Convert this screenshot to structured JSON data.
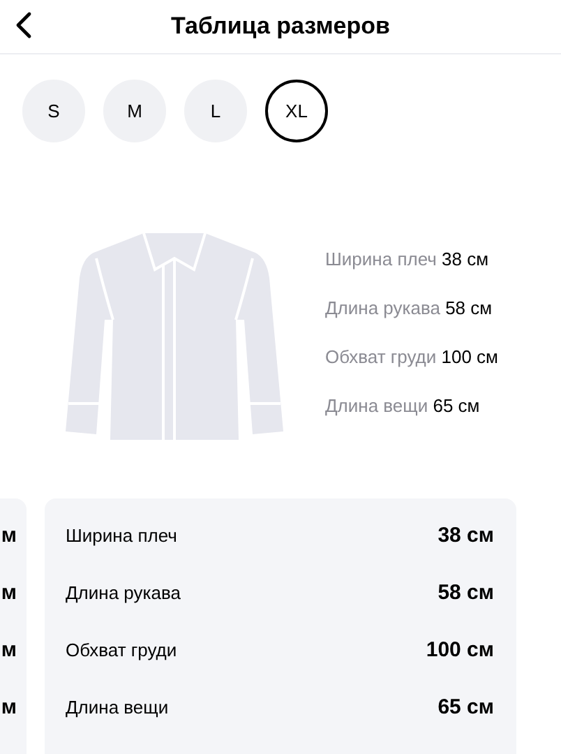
{
  "header": {
    "title": "Таблица размеров"
  },
  "sizes": [
    {
      "label": "S",
      "selected": false
    },
    {
      "label": "M",
      "selected": false
    },
    {
      "label": "L",
      "selected": false
    },
    {
      "label": "XL",
      "selected": true
    }
  ],
  "diagram": {
    "measurements": [
      {
        "label": "Ширина плеч",
        "value": "38 см"
      },
      {
        "label": "Длина рукава",
        "value": "58 см"
      },
      {
        "label": "Обхват груди",
        "value": "100 см"
      },
      {
        "label": "Длина вещи",
        "value": "65 см"
      }
    ]
  },
  "cards": [
    {
      "rows": [
        {
          "value": "м"
        },
        {
          "value": "м"
        },
        {
          "value": "м"
        },
        {
          "value": "м"
        }
      ]
    },
    {
      "rows": [
        {
          "label": "Ширина плеч",
          "value": "38 см"
        },
        {
          "label": "Длина рукава",
          "value": "58 см"
        },
        {
          "label": "Обхват груди",
          "value": "100 см"
        },
        {
          "label": "Длина вещи",
          "value": "65 см"
        }
      ]
    }
  ]
}
